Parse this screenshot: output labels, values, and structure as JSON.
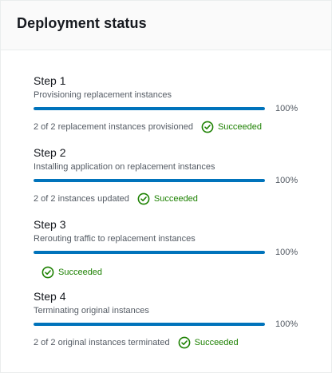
{
  "panel": {
    "title": "Deployment status"
  },
  "steps": [
    {
      "title": "Step 1",
      "description": "Provisioning replacement instances",
      "progress": 1.0,
      "progress_label": "100%",
      "detail": "2 of 2 replacement instances provisioned",
      "status": "Succeeded"
    },
    {
      "title": "Step 2",
      "description": "Installing application on replacement instances",
      "progress": 1.0,
      "progress_label": "100%",
      "detail": "2 of 2 instances updated",
      "status": "Succeeded"
    },
    {
      "title": "Step 3",
      "description": "Rerouting traffic to replacement instances",
      "progress": 1.0,
      "progress_label": "100%",
      "detail": "",
      "status": "Succeeded"
    },
    {
      "title": "Step 4",
      "description": "Terminating original instances",
      "progress": 1.0,
      "progress_label": "100%",
      "detail": "2 of 2 original instances terminated",
      "status": "Succeeded"
    }
  ],
  "colors": {
    "progress_fill": "#0073bb",
    "success": "#1d8102",
    "secondary_text": "#545b64"
  },
  "icons": {
    "status": "check-circle-icon"
  }
}
